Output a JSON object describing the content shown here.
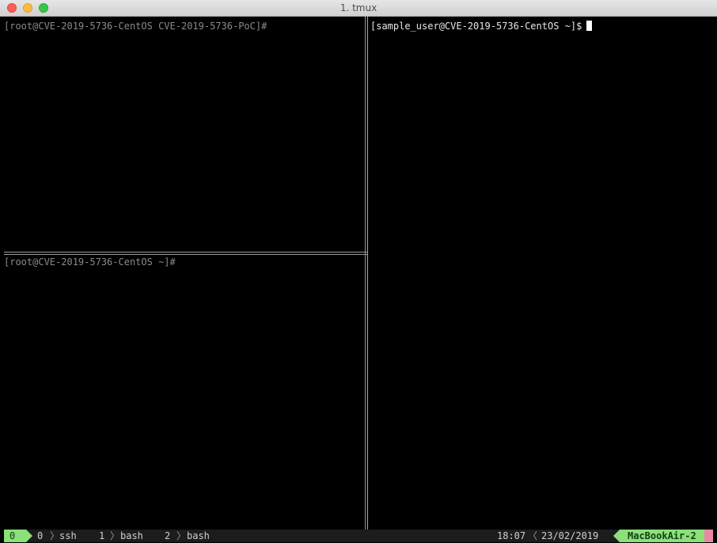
{
  "window": {
    "title": "1. tmux"
  },
  "panes": {
    "top_left": {
      "prompt": "[root@CVE-2019-5736-CentOS CVE-2019-5736-PoC]#"
    },
    "bottom_left": {
      "prompt": "[root@CVE-2019-5736-CentOS ~]#"
    },
    "right": {
      "prompt": "[sample_user@CVE-2019-5736-CentOS ~]$"
    }
  },
  "status_bar": {
    "session": "0",
    "windows": [
      {
        "index": "0",
        "name": "ssh"
      },
      {
        "index": "1",
        "name": "bash"
      },
      {
        "index": "2",
        "name": "bash"
      }
    ],
    "time": "18:07",
    "date": "23/02/2019",
    "host": "MacBookAir-2"
  },
  "colors": {
    "active_border": "#7bc86c",
    "status_accent": "#8be07a",
    "host_end_accent": "#e88aa6"
  },
  "icons": {
    "separator_right": "chevron-right",
    "separator_left": "chevron-left"
  }
}
